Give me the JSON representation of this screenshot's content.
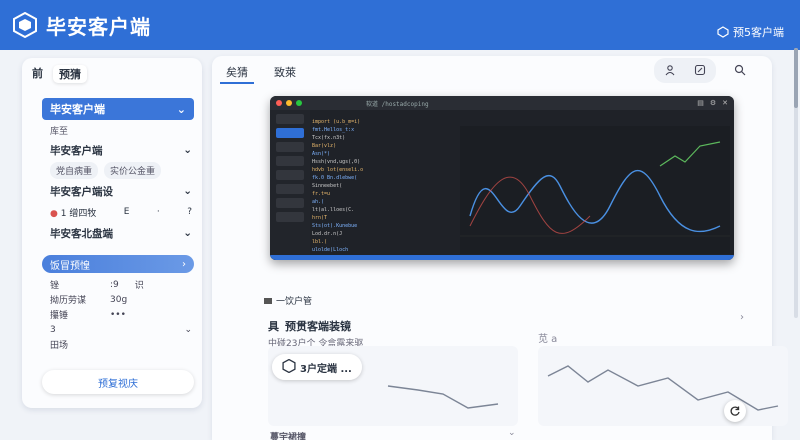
{
  "header": {
    "app_title": "毕安客户端",
    "top_tab": "",
    "pill_label": "预5客户端"
  },
  "left_panel": {
    "tabs": [
      "前",
      "预猜"
    ],
    "select_title": "毕安客户端",
    "sub_label": "库至",
    "group1_title": "毕安客户端",
    "chips": [
      "党自病重",
      "实价公金重"
    ],
    "group2_title": "毕安客户端设",
    "toolbar_item": "1 缯四牧",
    "toolbar_glyphs": [
      "E",
      "·",
      "?"
    ],
    "group3_title": "毕安客北盘端",
    "select2_title": "饭冒预惶",
    "kv": [
      {
        "k": "锉",
        "v1": ":9",
        "v2": "识"
      },
      {
        "k": "拗历劳谋",
        "v1": "30g",
        "v2": ""
      },
      {
        "k": "攥锤",
        "v1": "•••",
        "v2": ""
      },
      {
        "k": "3",
        "v1": "",
        "v2": ""
      },
      {
        "k": "田场",
        "v1": "",
        "v2": ""
      }
    ],
    "button_label": "预复视庆"
  },
  "main": {
    "tabs": [
      "矣猜",
      "致萊"
    ],
    "preview": {
      "title": "软道 /hostadcoping",
      "code_lines": [
        "import (u.b_m=i)",
        "  fmt.Hellos_t:x",
        "  Tcx(fx.n3t)",
        "  Bar(vlz)",
        "  Asn(*)",
        "  Hssh(vnd,ugs(,0)",
        "  hdvb lot(enseli.o",
        "  fk.0 Bn.dlebwe(",
        "  Sinneebet(",
        "  fr.t=u",
        "  ah.(",
        "  lt(al.lloes(C.",
        "  hrn(T",
        "  Sts(ot).Kunebue",
        "  Lod.dr.n(J",
        "  lbl.(",
        "  ulolde(Lloch"
      ]
    },
    "section_label": "一饮户管",
    "section_title_icon": "具",
    "section_title": "预贯客端装镜",
    "section_sub": "中碰23户个  令盒露来驱",
    "section_right_icon": "苋 a",
    "toast_label": "3户定端 ...",
    "bottom_label": "蔓宇裙撞"
  },
  "colors": {
    "brand": "#2f6fd6",
    "preview_bg": "#1f2228",
    "series_blue": "#4a90e2",
    "series_red": "#d9534f",
    "series_green": "#5cb85c"
  }
}
